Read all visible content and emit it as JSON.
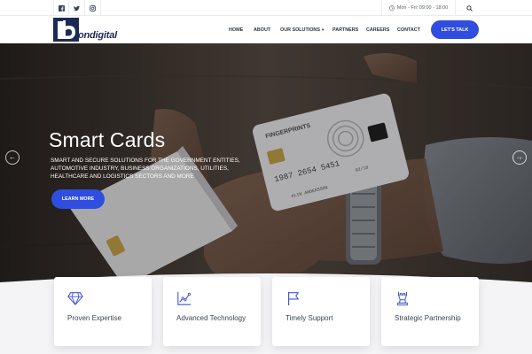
{
  "topbar": {
    "social_icons": [
      "facebook-icon",
      "twitter-icon",
      "instagram-icon"
    ],
    "hours": "Mon - Fri: 09:00 - 18:00"
  },
  "header": {
    "logo_text": "ondigital",
    "nav": [
      "HOME",
      "ABOUT",
      "OUR SOLUTIONS",
      "PARTNERS",
      "CAREERS",
      "CONTACT"
    ],
    "cta_label": "LET'S TALK"
  },
  "hero": {
    "title": "Smart Cards",
    "description": "SMART AND SECURE SOLUTIONS FOR THE GOVERNMENT ENTITIES, AUTOMOTIVE INDUSTRY, BUSINESS ORGANIZATIONS, UTILITIES, HEALTHCARE AND LOGISTICS SECTORS AND MORE",
    "button_label": "LEARN MORE",
    "card_brand": "FINGERPRINTS",
    "card_number": "1987 2654 5451",
    "card_expiry": "02/18",
    "card_holder": "KLIN ANDERSSON"
  },
  "features": [
    {
      "label": "Proven Expertise",
      "icon": "diamond-icon"
    },
    {
      "label": "Advanced Technology",
      "icon": "growth-chart-icon"
    },
    {
      "label": "Timely Support",
      "icon": "flag-icon"
    },
    {
      "label": "Strategic Partnership",
      "icon": "chess-piece-icon"
    }
  ],
  "colors": {
    "accent": "#2f4ddf",
    "icon_blue": "#3f56d6",
    "nav_text": "#2b3440"
  }
}
